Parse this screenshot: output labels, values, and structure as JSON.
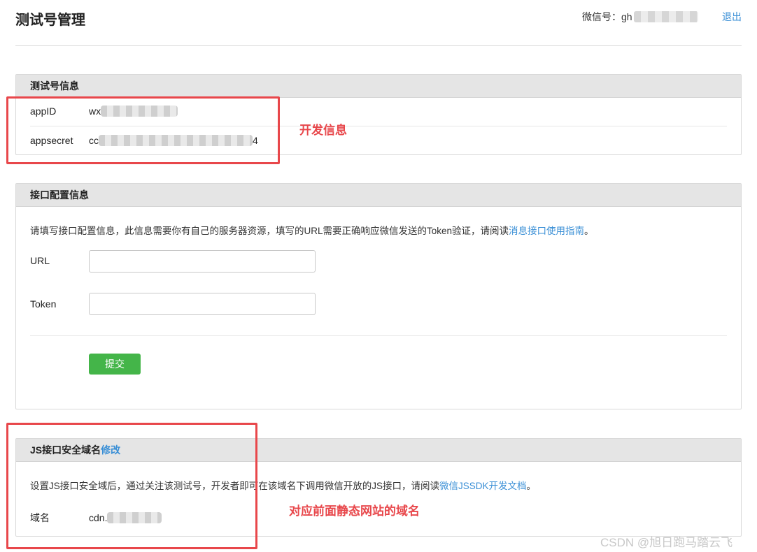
{
  "header": {
    "title": "测试号管理",
    "account_label": "微信号：gh",
    "logout_label": "退出"
  },
  "test_info": {
    "title": "测试号信息",
    "appid_label": "appID",
    "appid_prefix": "wx",
    "appsecret_label": "appsecret",
    "appsecret_prefix": "cc",
    "appsecret_suffix": "4"
  },
  "interface": {
    "title": "接口配置信息",
    "desc_text": "请填写接口配置信息，此信息需要你有自己的服务器资源，填写的URL需要正确响应微信发送的Token验证，请阅读",
    "desc_link": "消息接口使用指南",
    "desc_end": "。",
    "url_label": "URL",
    "url_value": "",
    "token_label": "Token",
    "token_value": "",
    "submit_label": "提交"
  },
  "js_domain": {
    "title": "JS接口安全域名",
    "edit_link": "修改",
    "desc_text": "设置JS接口安全域后，通过关注该测试号，开发者即可在该域名下调用微信开放的JS接口，请阅读",
    "desc_link": "微信JSSDK开发文档",
    "desc_end": "。",
    "domain_label": "域名",
    "domain_prefix": "cdn."
  },
  "annotations": {
    "dev_info": "开发信息",
    "domain_note": "对应前面静态网站的域名"
  },
  "watermark": "CSDN @旭日跑马踏云飞",
  "colors": {
    "link": "#3a8fd6",
    "submit_green": "#44b549",
    "annotation_red": "#e8474b",
    "panel_header": "#e5e5e5"
  }
}
